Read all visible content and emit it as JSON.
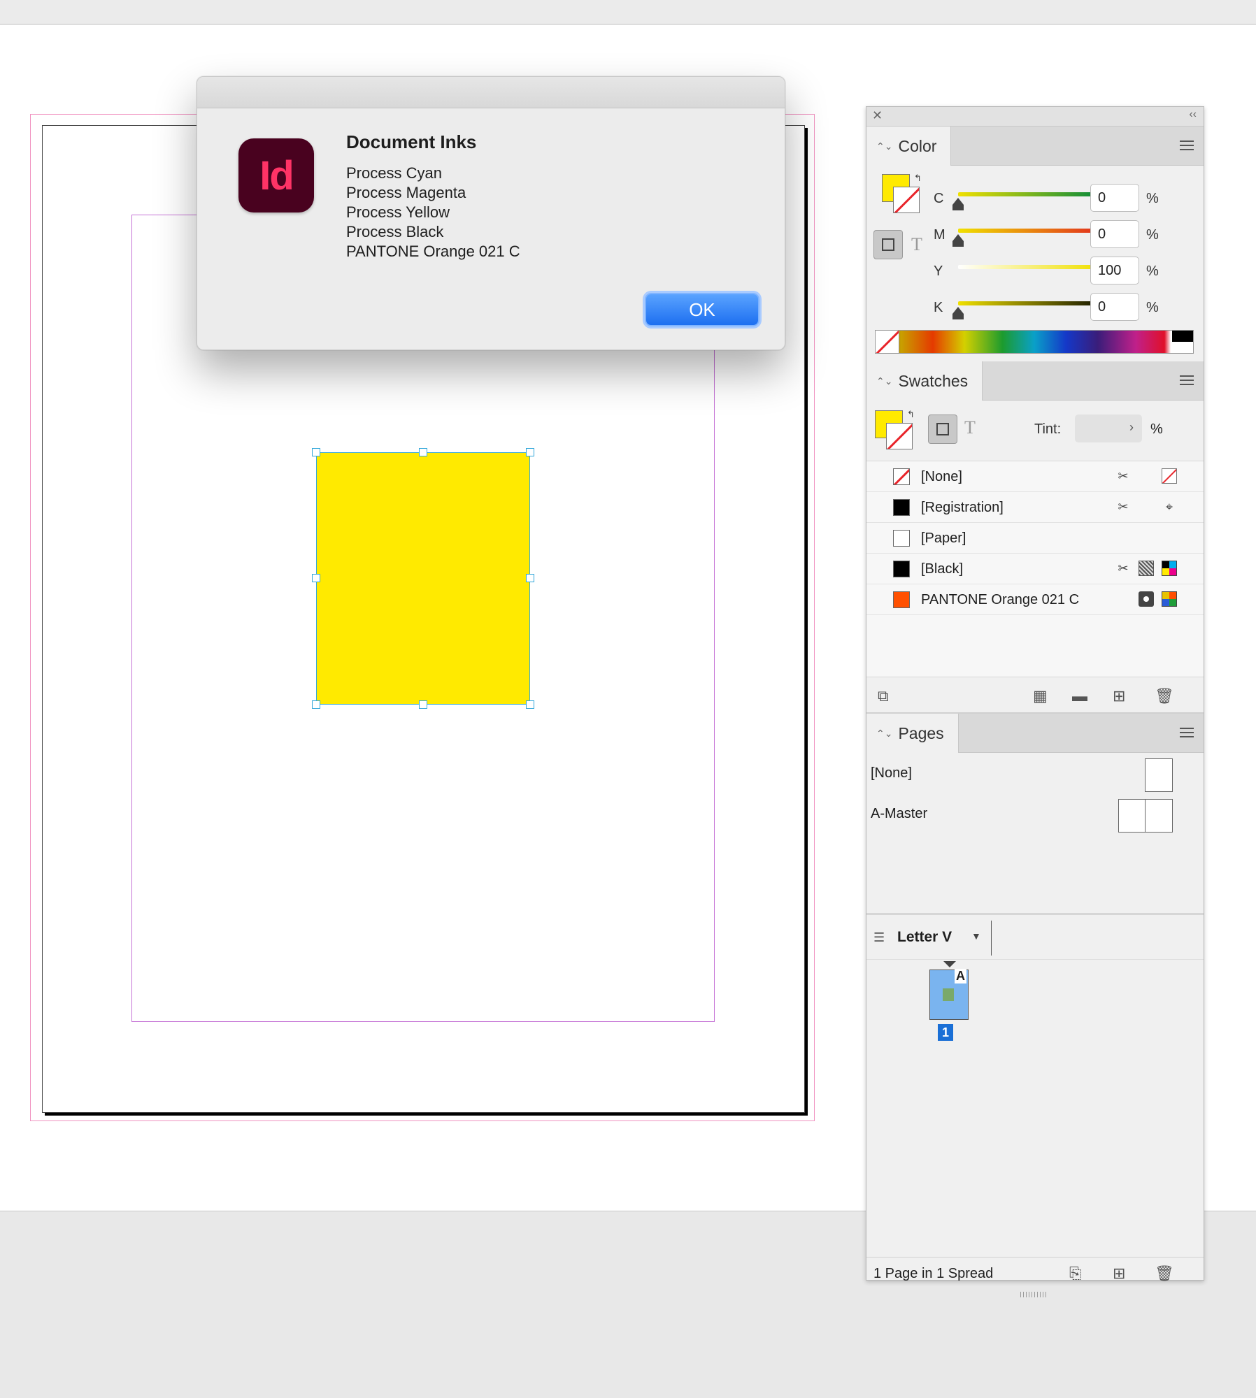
{
  "dialog": {
    "app_icon_text": "Id",
    "title": "Document Inks",
    "inks": [
      "Process Cyan",
      "Process Magenta",
      "Process Yellow",
      "Process Black",
      "PANTONE Orange 021 C"
    ],
    "ok_label": "OK"
  },
  "document": {
    "frame_fill_color": "#ffea00"
  },
  "color_panel": {
    "tab_label": "Color",
    "fill_color": "#ffea00",
    "channels": [
      {
        "label": "C",
        "value": "0",
        "unit": "%",
        "level": 0
      },
      {
        "label": "M",
        "value": "0",
        "unit": "%",
        "level": 0
      },
      {
        "label": "Y",
        "value": "100",
        "unit": "%",
        "level": 1
      },
      {
        "label": "K",
        "value": "0",
        "unit": "%",
        "level": 0
      }
    ]
  },
  "swatches_panel": {
    "tab_label": "Swatches",
    "tint_label": "Tint:",
    "tint_unit": "%",
    "items": [
      {
        "name": "[None]",
        "color": "none"
      },
      {
        "name": "[Registration]",
        "color": "#000000"
      },
      {
        "name": "[Paper]",
        "color": "#ffffff"
      },
      {
        "name": "[Black]",
        "color": "#000000"
      },
      {
        "name": "PANTONE Orange 021 C",
        "color": "#ff5000"
      }
    ]
  },
  "pages_panel": {
    "tab_label": "Pages",
    "masters": [
      "[None]",
      "A-Master"
    ],
    "page_size": "Letter V",
    "page_master_letter": "A",
    "page_number": "1",
    "status": "1 Page in 1 Spread"
  }
}
